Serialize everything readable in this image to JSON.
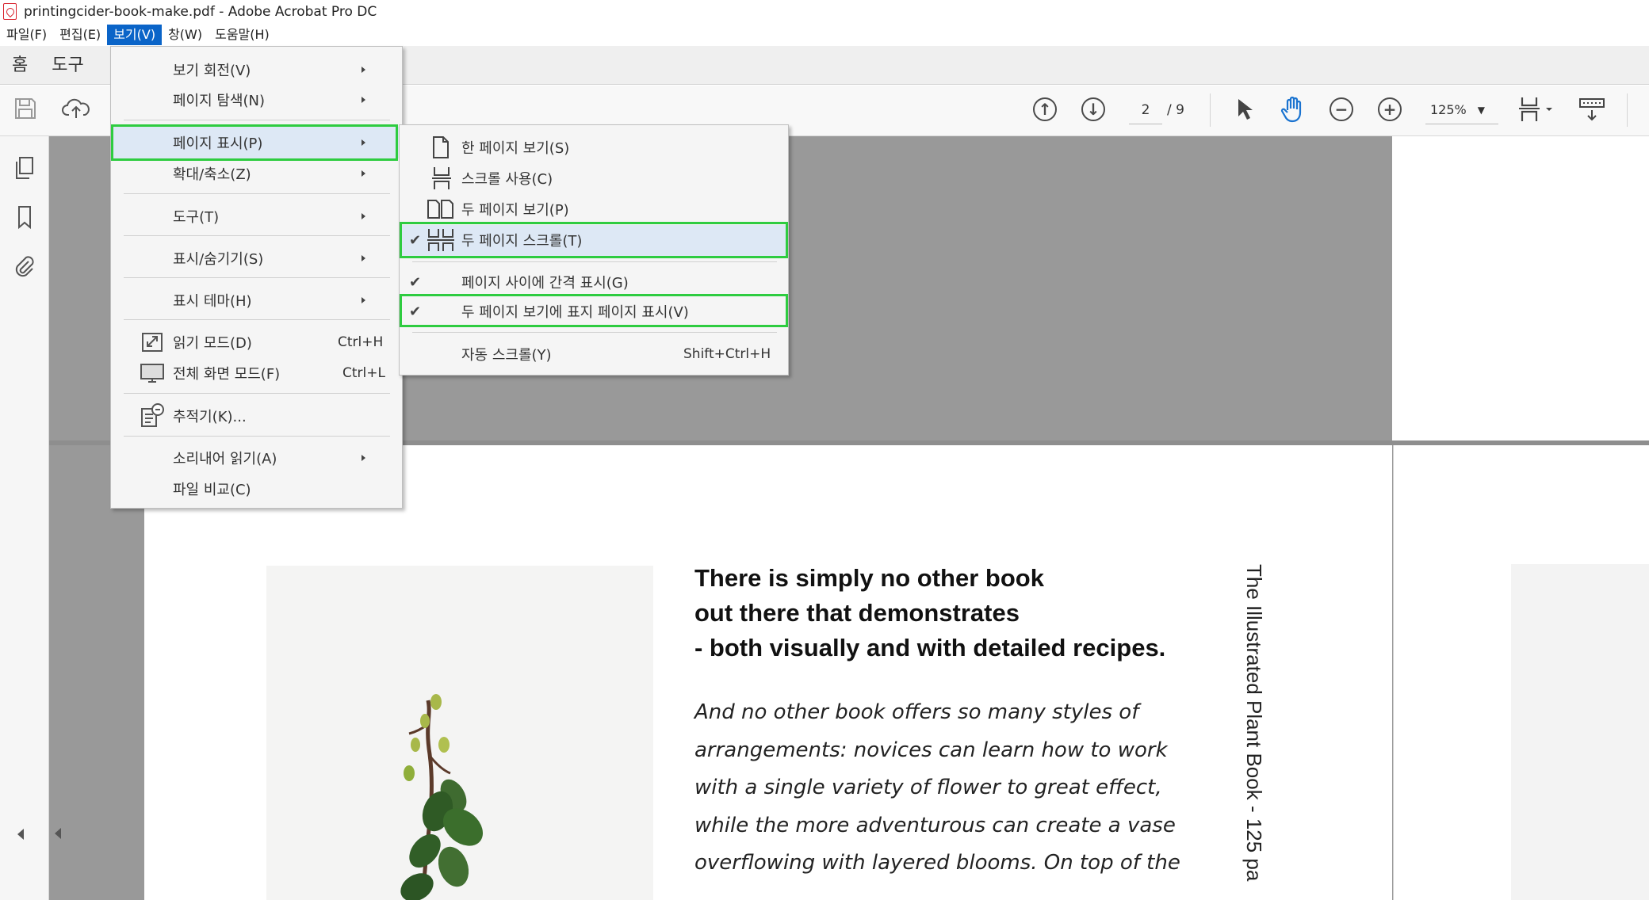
{
  "window": {
    "title": "printingcider-book-make.pdf - Adobe Acrobat Pro DC"
  },
  "menubar": {
    "items": [
      "파일(F)",
      "편집(E)",
      "보기(V)",
      "창(W)",
      "도움말(H)"
    ],
    "active_index": 2
  },
  "tabs": [
    "홈",
    "도구"
  ],
  "toolbar": {
    "page_current": "2",
    "page_total": "/ 9",
    "zoom": "125%"
  },
  "view_menu": {
    "items": [
      {
        "label": "보기 회전(V)",
        "submenu": true
      },
      {
        "label": "페이지 탐색(N)",
        "submenu": true
      },
      {
        "label": "페이지 표시(P)",
        "submenu": true,
        "highlighted": true
      },
      {
        "label": "확대/축소(Z)",
        "submenu": true
      },
      {
        "label": "도구(T)",
        "submenu": true
      },
      {
        "label": "표시/숨기기(S)",
        "submenu": true
      },
      {
        "label": "표시 테마(H)",
        "submenu": true
      },
      {
        "label": "읽기 모드(D)",
        "shortcut": "Ctrl+H",
        "icon": "reading-mode-icon"
      },
      {
        "label": "전체 화면 모드(F)",
        "shortcut": "Ctrl+L",
        "icon": "fullscreen-icon"
      },
      {
        "label": "추적기(K)...",
        "icon": "tracker-icon"
      },
      {
        "label": "소리내어 읽기(A)",
        "submenu": true
      },
      {
        "label": "파일 비교(C)"
      }
    ]
  },
  "page_display_submenu": {
    "items": [
      {
        "label": "한 페이지 보기(S)",
        "icon": "single-page-icon",
        "checked": false
      },
      {
        "label": "스크롤 사용(C)",
        "icon": "scrolling-icon",
        "checked": false
      },
      {
        "label": "두 페이지 보기(P)",
        "icon": "two-page-icon",
        "checked": false
      },
      {
        "label": "두 페이지 스크롤(T)",
        "icon": "two-page-scroll-icon",
        "checked": true,
        "highlighted": true
      },
      {
        "label": "페이지 사이에 간격 표시(G)",
        "checked": true
      },
      {
        "label": "두 페이지 보기에 표지 페이지 표시(V)",
        "checked": true,
        "highlighted": true
      },
      {
        "label": "자동 스크롤(Y)",
        "shortcut": "Shift+Ctrl+H",
        "checked": false
      }
    ]
  },
  "document": {
    "lead_lines": [
      "There is simply no other book",
      "out there that demonstrates",
      "- both visually and with detailed recipes."
    ],
    "body_lines": [
      "And no other book offers so many styles of",
      "arrangements: novices can learn how to work",
      "with a single variety of flower to great effect,",
      "while the more adventurous can create a vase",
      "overflowing with layered blooms. On top of the"
    ],
    "vertical_title": "The Illustrated Plant Book - 125 pa"
  },
  "colors": {
    "menu_active": "#0a64c8",
    "highlight_box": "#2ecc40",
    "doc_background": "#999999"
  }
}
